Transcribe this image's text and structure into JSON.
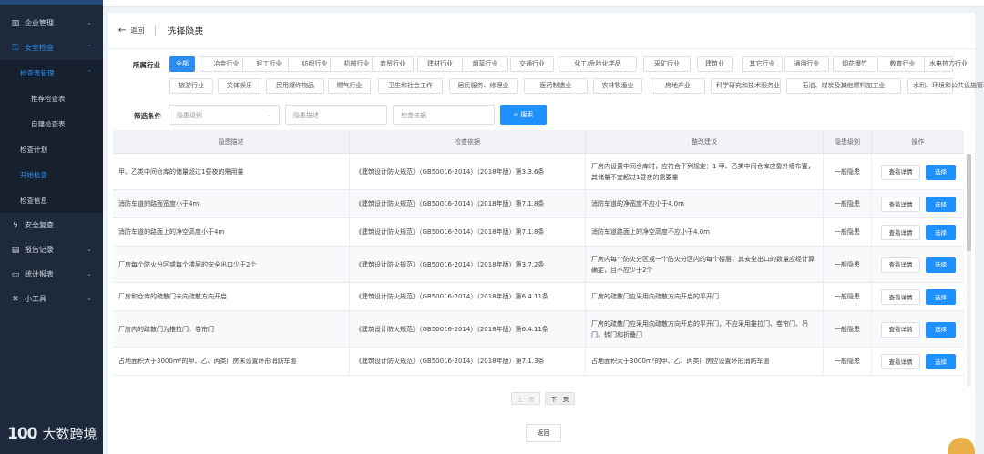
{
  "sidebar": {
    "items": [
      {
        "label": "企业管理",
        "icon": "building-icon"
      },
      {
        "label": "安全检查",
        "icon": "inspection-icon"
      },
      {
        "label": "安全复查",
        "icon": "lightning-icon"
      },
      {
        "label": "报告记录",
        "icon": "report-icon"
      },
      {
        "label": "统计报表",
        "icon": "folder-icon"
      },
      {
        "label": "小工具",
        "icon": "tools-icon"
      }
    ],
    "sub": {
      "group": "检查表管理",
      "recommend": "推荐检查表",
      "custom": "自建检查表",
      "plan": "检查计划",
      "start": "开始检查",
      "info": "检查信息"
    }
  },
  "header": {
    "back": "返回",
    "title": "选择隐患"
  },
  "categories": {
    "label": "所属行业",
    "tags": [
      "全部",
      "冶金行业",
      "轻工行业",
      "纺织行业",
      "机械行业",
      "商贸行业",
      "建材行业",
      "烟草行业",
      "交通行业",
      "化工/危险化学品",
      "采矿行业",
      "建筑业",
      "其它行业",
      "通用行业",
      "烟花爆竹",
      "教育行业",
      "水电热力行业",
      "旅游行业",
      "文体娱乐",
      "民用爆炸物品",
      "燃气行业",
      "卫生和社会工作",
      "居民服务、修理业",
      "医药制造业",
      "农林牧渔业",
      "房地产业",
      "科学研究和技术服务业",
      "石油、煤炭及其他燃料加工业",
      "水利、环境和公共设施管理业"
    ]
  },
  "filter": {
    "label": "筛选条件",
    "level_placeholder": "隐患级别",
    "desc_placeholder": "隐患描述",
    "basis_placeholder": "检查依据",
    "search_label": "搜索"
  },
  "table": {
    "headers": [
      "隐患描述",
      "检查依据",
      "整改建议",
      "隐患级别",
      "操作"
    ],
    "rows": [
      {
        "desc": "甲、乙类中间仓库的储量超过1昼夜的需用量",
        "basis": "《建筑设计防火规范》（GB50016-2014）（2018年版）第3.3.6条",
        "advice": "厂房内设置中间仓库时，应符合下列规定：1 甲、乙类中间仓库应靠外墙布置，其储量不宜超过1昼夜的需要量",
        "level": "一般隐患"
      },
      {
        "desc": "消防车道的路面宽度小于4m",
        "basis": "《建筑设计防火规范》（GB50016-2014）（2018年版）第7.1.8条",
        "advice": "消防车道的净宽度不应小于4.0m",
        "level": "一般隐患"
      },
      {
        "desc": "消防车道的路面上的净空高度小于4m",
        "basis": "《建筑设计防火规范》（GB50016-2014）（2018年版）第7.1.8条",
        "advice": "消防车道路面上的净空高度不应小于4.0m",
        "level": "一般隐患"
      },
      {
        "desc": "厂房每个防火分区或每个楼层的安全出口少于2个",
        "basis": "《建筑设计防火规范》（GB50016-2014）（2018年版）第3.7.2条",
        "advice": "厂房内每个防火分区或一个防火分区内的每个楼层，其安全出口的数量应经计算确定，且不应少于2个",
        "level": "一般隐患"
      },
      {
        "desc": "厂房和仓库的疏散门未向疏散方向开启",
        "basis": "《建筑设计防火规范》（GB50016-2014）（2018年版）第6.4.11条",
        "advice": "厂房的疏散门应采用向疏散方向开启的平开门",
        "level": "一般隐患"
      },
      {
        "desc": "厂房内的疏散门为推拉门、卷帘门",
        "basis": "《建筑设计防火规范》（GB50016-2014）（2018年版）第6.4.11条",
        "advice": "厂房的疏散门应采用向疏散方向开启的平开门，不应采用推拉门、卷帘门、吊门、转门和折叠门",
        "level": "一般隐患"
      },
      {
        "desc": "占地面积大于3000m²的甲、乙、丙类厂房未设置环形消防车道",
        "basis": "《建筑设计防火规范》（GB50016-2014）（2018年版）第7.1.3条",
        "advice": "占地面积大于3000m²的甲、乙、丙类厂房应设置环形消防车道",
        "level": "一般隐患"
      }
    ],
    "detail_label": "查看详情",
    "select_label": "选择"
  },
  "pagination": {
    "prev": "上一页",
    "next": "下一页"
  },
  "footer": {
    "back": "返回"
  },
  "watermark": {
    "logo": "100",
    "text": "大数跨境"
  },
  "colors": {
    "primary": "#1e90ff",
    "sidebar": "#1e2a3b",
    "active_text": "#2d8cf0"
  }
}
